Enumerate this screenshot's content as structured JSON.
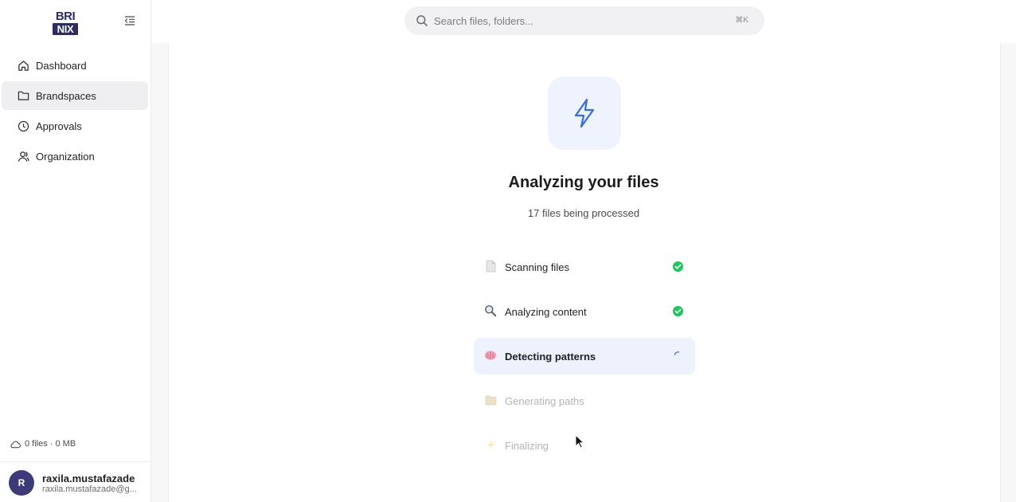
{
  "brand": {
    "logo_top": "BRI",
    "logo_bottom": "NIX"
  },
  "search": {
    "placeholder": "Search files, folders...",
    "shortcut": "⌘K"
  },
  "sidebar": {
    "items": [
      {
        "label": "Dashboard",
        "icon": "home-icon",
        "active": false
      },
      {
        "label": "Brandspaces",
        "icon": "folder-icon",
        "active": true
      },
      {
        "label": "Approvals",
        "icon": "clock-icon",
        "active": false
      },
      {
        "label": "Organization",
        "icon": "users-icon",
        "active": false
      }
    ],
    "storage": "0 files · 0 MB",
    "user": {
      "initial": "R",
      "name": "raxila.mustafazade",
      "email": "raxila.mustafazade@g..."
    }
  },
  "main": {
    "hero_icon": "lightning-icon",
    "title": "Analyzing your files",
    "subtitle": "17 files being processed",
    "steps": [
      {
        "label": "Scanning files",
        "icon": "document-icon",
        "status": "done"
      },
      {
        "label": "Analyzing content",
        "icon": "magnifier-icon",
        "status": "done"
      },
      {
        "label": "Detecting patterns",
        "icon": "brain-icon",
        "status": "in-progress"
      },
      {
        "label": "Generating paths",
        "icon": "folder-icon",
        "status": "pending"
      },
      {
        "label": "Finalizing",
        "icon": "sparkle-icon",
        "status": "pending"
      }
    ]
  },
  "colors": {
    "accent": "#3b6fd9",
    "success": "#22c55e",
    "brand_navy": "#2c2d5e",
    "active_nav_bg": "#efeff1",
    "current_step_bg": "#eef2fd"
  }
}
